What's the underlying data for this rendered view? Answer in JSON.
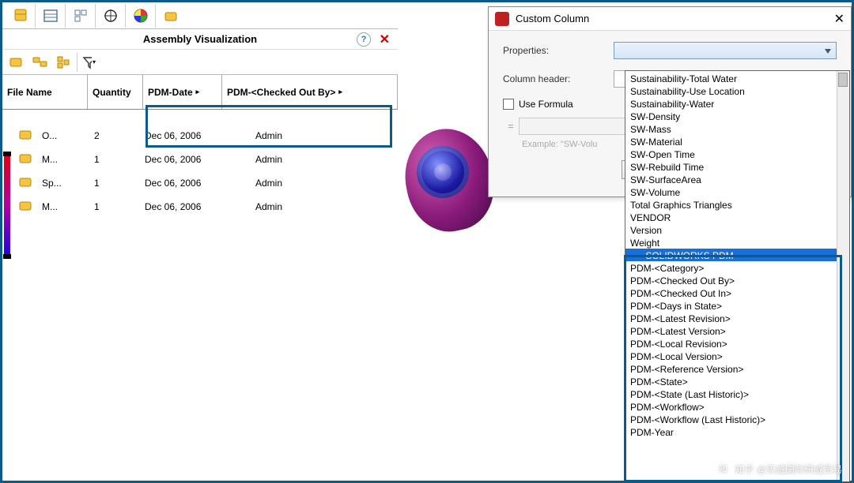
{
  "panel": {
    "title": "Assembly Visualization",
    "columns": {
      "file": "File Name",
      "qty": "Quantity",
      "date": "PDM-Date",
      "cob": "PDM-<Checked Out By>"
    },
    "rows": [
      {
        "file": "O...",
        "qty": "2",
        "date": "Dec 06, 2006",
        "cob": "Admin"
      },
      {
        "file": "M...",
        "qty": "1",
        "date": "Dec 06, 2006",
        "cob": "Admin"
      },
      {
        "file": "Sp...",
        "qty": "1",
        "date": "Dec 06, 2006",
        "cob": "Admin"
      },
      {
        "file": "M...",
        "qty": "1",
        "date": "Dec 06, 2006",
        "cob": "Admin"
      }
    ]
  },
  "dialog": {
    "title": "Custom Column",
    "properties_label": "Properties:",
    "header_label": "Column header:",
    "use_formula": "Use Formula",
    "example": "Example: \"SW-Volu",
    "eq": "="
  },
  "dropdown": {
    "top": [
      "Sustainability-Total Water",
      "Sustainability-Use Location",
      "Sustainability-Water",
      "SW-Density",
      "SW-Mass",
      "SW-Material",
      "SW-Open Time",
      "SW-Rebuild Time",
      "SW-SurfaceArea",
      "SW-Volume",
      "Total Graphics Triangles",
      "VENDOR",
      "Version",
      "Weight"
    ],
    "sep": "---- SOLIDWORKS PDM ----",
    "pdm": [
      "PDM-<Category>",
      "PDM-<Checked Out By>",
      "PDM-<Checked Out In>",
      "PDM-<Days in State>",
      "PDM-<Latest Revision>",
      "PDM-<Latest Version>",
      "PDM-<Local Revision>",
      "PDM-<Local Version>",
      "PDM-<Reference Version>",
      "PDM-<State>",
      "PDM-<State (Last Historic)>",
      "PDM-<Workflow>",
      "PDM-<Workflow (Last Historic)>",
      "PDM-Year"
    ]
  },
  "watermark": "知乎 @实威国际研威贸易"
}
